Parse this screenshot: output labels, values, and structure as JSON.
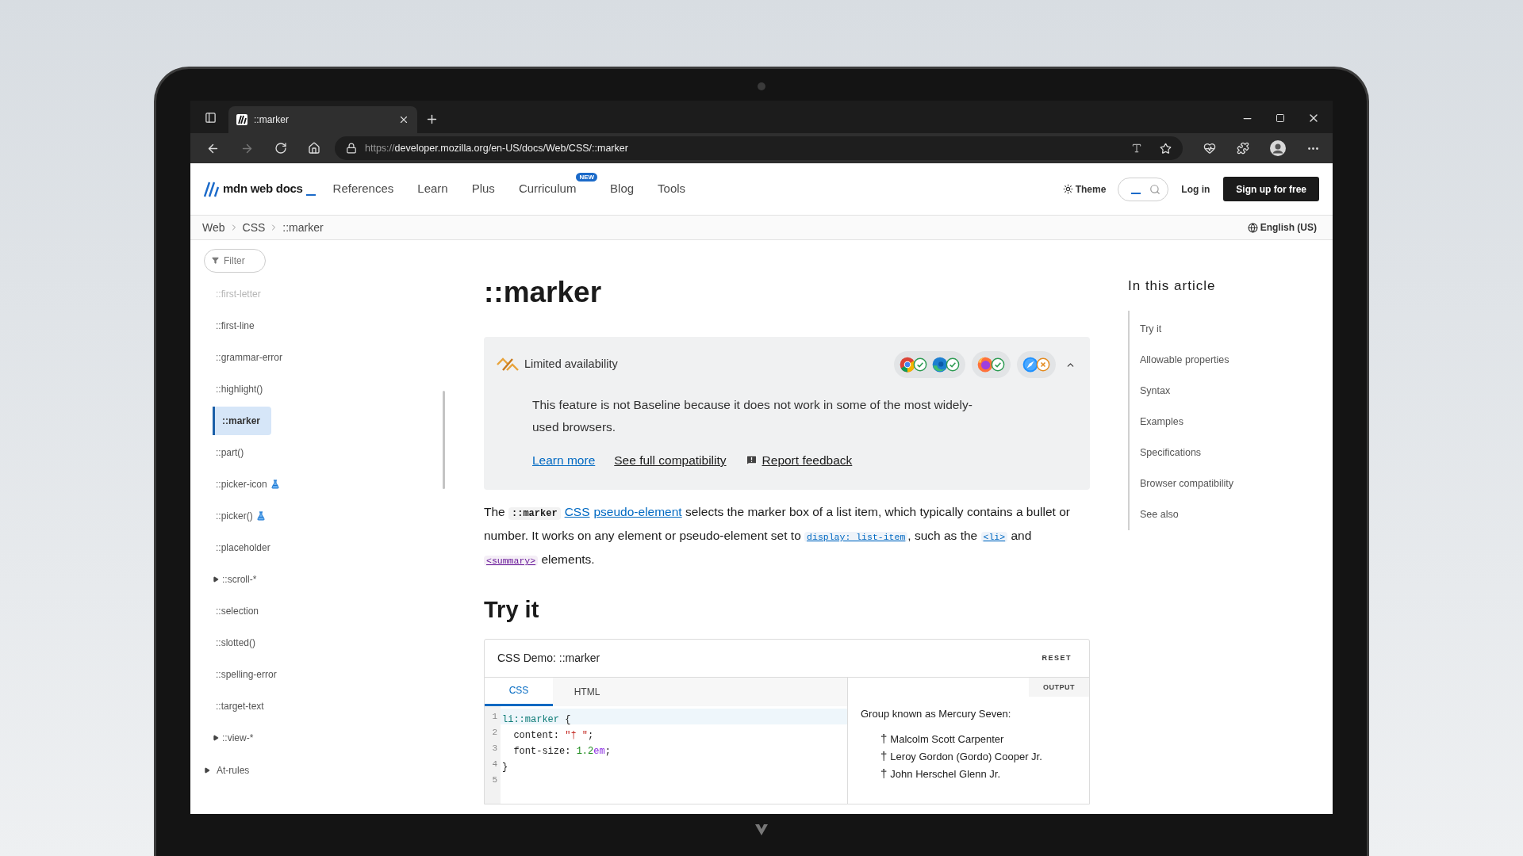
{
  "browser": {
    "tab_title": "::marker",
    "url_scheme": "https://",
    "url_path": "developer.mozilla.org/en-US/docs/Web/CSS/::marker"
  },
  "header": {
    "logo": "mdn web docs",
    "nav": [
      {
        "label": "References"
      },
      {
        "label": "Learn"
      },
      {
        "label": "Plus"
      },
      {
        "label": "Curriculum",
        "badge": "NEW"
      },
      {
        "label": "Blog"
      },
      {
        "label": "Tools"
      }
    ],
    "theme": "Theme",
    "login": "Log in",
    "signup": "Sign up for free"
  },
  "breadcrumbs": [
    "Web",
    "CSS",
    "::marker"
  ],
  "language": "English (US)",
  "sidebar": {
    "filter_placeholder": "Filter",
    "items": [
      {
        "label": "::first-letter",
        "kind": "link",
        "selected": false,
        "dimmed": true,
        "experimental": false
      },
      {
        "label": "::first-line",
        "kind": "link",
        "selected": false,
        "dimmed": false,
        "experimental": false
      },
      {
        "label": "::grammar-error",
        "kind": "link",
        "selected": false,
        "dimmed": false,
        "experimental": false
      },
      {
        "label": "::highlight()",
        "kind": "link",
        "selected": false,
        "dimmed": false,
        "experimental": false
      },
      {
        "label": "::marker",
        "kind": "link",
        "selected": true,
        "dimmed": false,
        "experimental": false
      },
      {
        "label": "::part()",
        "kind": "link",
        "selected": false,
        "dimmed": false,
        "experimental": false
      },
      {
        "label": "::picker-icon",
        "kind": "link",
        "selected": false,
        "dimmed": false,
        "experimental": true
      },
      {
        "label": "::picker()",
        "kind": "link",
        "selected": false,
        "dimmed": false,
        "experimental": true
      },
      {
        "label": "::placeholder",
        "kind": "link",
        "selected": false,
        "dimmed": false,
        "experimental": false
      },
      {
        "label": "::scroll-*",
        "kind": "group",
        "selected": false,
        "dimmed": false,
        "experimental": false,
        "expanded": false
      },
      {
        "label": "::selection",
        "kind": "link",
        "selected": false,
        "dimmed": false,
        "experimental": false
      },
      {
        "label": "::slotted()",
        "kind": "link",
        "selected": false,
        "dimmed": false,
        "experimental": false
      },
      {
        "label": "::spelling-error",
        "kind": "link",
        "selected": false,
        "dimmed": false,
        "experimental": false
      },
      {
        "label": "::target-text",
        "kind": "link",
        "selected": false,
        "dimmed": false,
        "experimental": false
      },
      {
        "label": "::view-*",
        "kind": "group",
        "selected": false,
        "dimmed": false,
        "experimental": false,
        "expanded": false
      }
    ],
    "sections": [
      {
        "label": "At-rules",
        "expanded": false
      }
    ]
  },
  "article": {
    "title": "::marker",
    "banner": {
      "title": "Limited availability",
      "expanded": true,
      "browser_groups": [
        {
          "browsers": [
            {
              "kind": "chrome",
              "supported": true
            },
            {
              "kind": "edge",
              "supported": true
            }
          ]
        },
        {
          "browsers": [
            {
              "kind": "firefox",
              "supported": true
            }
          ]
        },
        {
          "browsers": [
            {
              "kind": "safari",
              "supported": false
            }
          ]
        }
      ],
      "text": "This feature is not Baseline because it does not work in some of the most widely-used browsers.",
      "links": [
        {
          "label": "Learn more",
          "kind": "link"
        },
        {
          "label": "See full compatibility",
          "kind": "plain"
        },
        {
          "label": "Report feedback",
          "kind": "feedback"
        }
      ]
    },
    "intro": [
      {
        "kind": "text",
        "text": "The "
      },
      {
        "kind": "code",
        "text": "::marker"
      },
      {
        "kind": "link",
        "text": "CSS"
      },
      {
        "kind": "link",
        "text": "pseudo-element"
      },
      {
        "kind": "text",
        "text": " selects the marker box of a list item, which typically contains a bullet or number. It works on any element or pseudo-element set to "
      },
      {
        "kind": "code_link",
        "text": "display: list-item"
      },
      {
        "kind": "text",
        "text": ", such as the "
      },
      {
        "kind": "code_link",
        "text": "<li>"
      },
      {
        "kind": "text",
        "text": " and "
      },
      {
        "kind": "code_link_visited",
        "text": "<summary>"
      },
      {
        "kind": "text",
        "text": " elements."
      }
    ],
    "section_heading": "Try it",
    "demo": {
      "title": "CSS Demo: ::marker",
      "reset": "RESET",
      "tabs": [
        {
          "label": "CSS",
          "selected": true
        },
        {
          "label": "HTML",
          "selected": false
        }
      ],
      "lines": [
        {
          "number": "1",
          "active": true,
          "tokens": [
            {
              "kind": "selector",
              "text": "li::marker"
            },
            {
              "kind": "plain",
              "text": " {"
            }
          ]
        },
        {
          "number": "2",
          "active": false,
          "tokens": [
            {
              "kind": "plain",
              "text": "  content: "
            },
            {
              "kind": "string",
              "text": "\"† \""
            },
            {
              "kind": "plain",
              "text": ";"
            }
          ]
        },
        {
          "number": "3",
          "active": false,
          "tokens": [
            {
              "kind": "plain",
              "text": "  font-size: "
            },
            {
              "kind": "number",
              "text": "1.2"
            },
            {
              "kind": "unit",
              "text": "em"
            },
            {
              "kind": "plain",
              "text": ";"
            }
          ]
        },
        {
          "number": "4",
          "active": false,
          "tokens": [
            {
              "kind": "plain",
              "text": "}"
            }
          ]
        },
        {
          "number": "5",
          "active": false
        }
      ],
      "output": {
        "label": "OUTPUT",
        "heading": "Group known as Mercury Seven:",
        "items": [
          {
            "marker": "†",
            "text": "Malcolm Scott Carpenter"
          },
          {
            "marker": "†",
            "text": "Leroy Gordon (Gordo) Cooper Jr."
          },
          {
            "marker": "†",
            "text": "John Herschel Glenn Jr."
          }
        ]
      }
    }
  },
  "toc": {
    "title": "In this article",
    "items": [
      "Try it",
      "Allowable properties",
      "Syntax",
      "Examples",
      "Specifications",
      "Browser compatibility",
      "See also"
    ]
  }
}
